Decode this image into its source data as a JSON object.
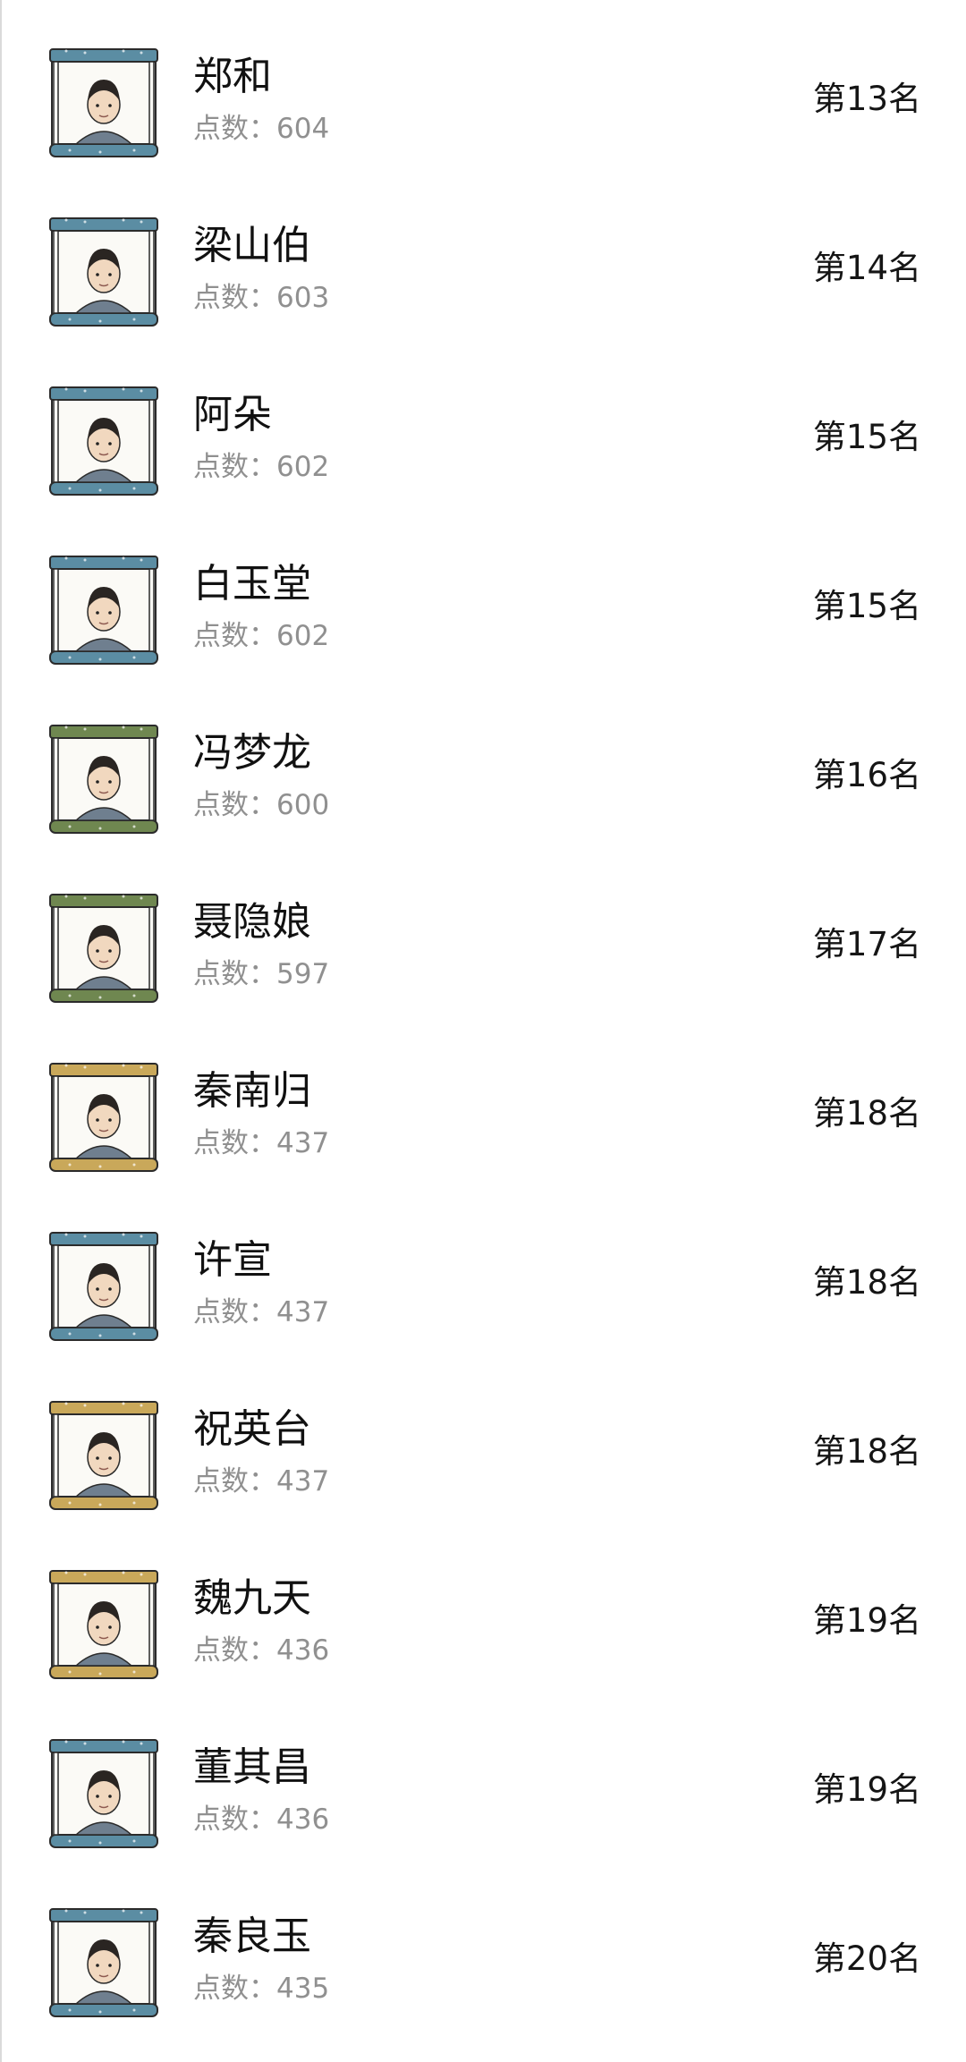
{
  "rankings": [
    {
      "name": "郑和",
      "score": "点数：604",
      "rank": "第13名",
      "frame_color": "#5b8da3",
      "avatar_icon": "portrait-zheng-he-icon"
    },
    {
      "name": "梁山伯",
      "score": "点数：603",
      "rank": "第14名",
      "frame_color": "#5b8da3",
      "avatar_icon": "portrait-liang-shanbo-icon"
    },
    {
      "name": "阿朵",
      "score": "点数：602",
      "rank": "第15名",
      "frame_color": "#5b8da3",
      "avatar_icon": "portrait-a-duo-icon"
    },
    {
      "name": "白玉堂",
      "score": "点数：602",
      "rank": "第15名",
      "frame_color": "#5b8da3",
      "avatar_icon": "portrait-bai-yutang-icon"
    },
    {
      "name": "冯梦龙",
      "score": "点数：600",
      "rank": "第16名",
      "frame_color": "#6f8750",
      "avatar_icon": "portrait-feng-menglong-icon"
    },
    {
      "name": "聂隐娘",
      "score": "点数：597",
      "rank": "第17名",
      "frame_color": "#6f8750",
      "avatar_icon": "portrait-nie-yinniang-icon"
    },
    {
      "name": "秦南归",
      "score": "点数：437",
      "rank": "第18名",
      "frame_color": "#c9a85a",
      "avatar_icon": "portrait-qin-nangui-icon"
    },
    {
      "name": "许宣",
      "score": "点数：437",
      "rank": "第18名",
      "frame_color": "#5b8da3",
      "avatar_icon": "portrait-xu-xuan-icon"
    },
    {
      "name": "祝英台",
      "score": "点数：437",
      "rank": "第18名",
      "frame_color": "#c9a85a",
      "avatar_icon": "portrait-zhu-yingtai-icon"
    },
    {
      "name": "魏九天",
      "score": "点数：436",
      "rank": "第19名",
      "frame_color": "#c9a85a",
      "avatar_icon": "portrait-wei-jiutian-icon"
    },
    {
      "name": "董其昌",
      "score": "点数：436",
      "rank": "第19名",
      "frame_color": "#5b8da3",
      "avatar_icon": "portrait-dong-qichang-icon"
    },
    {
      "name": "秦良玉",
      "score": "点数：435",
      "rank": "第20名",
      "frame_color": "#5b8da3",
      "avatar_icon": "portrait-qin-liangyu-icon"
    }
  ]
}
